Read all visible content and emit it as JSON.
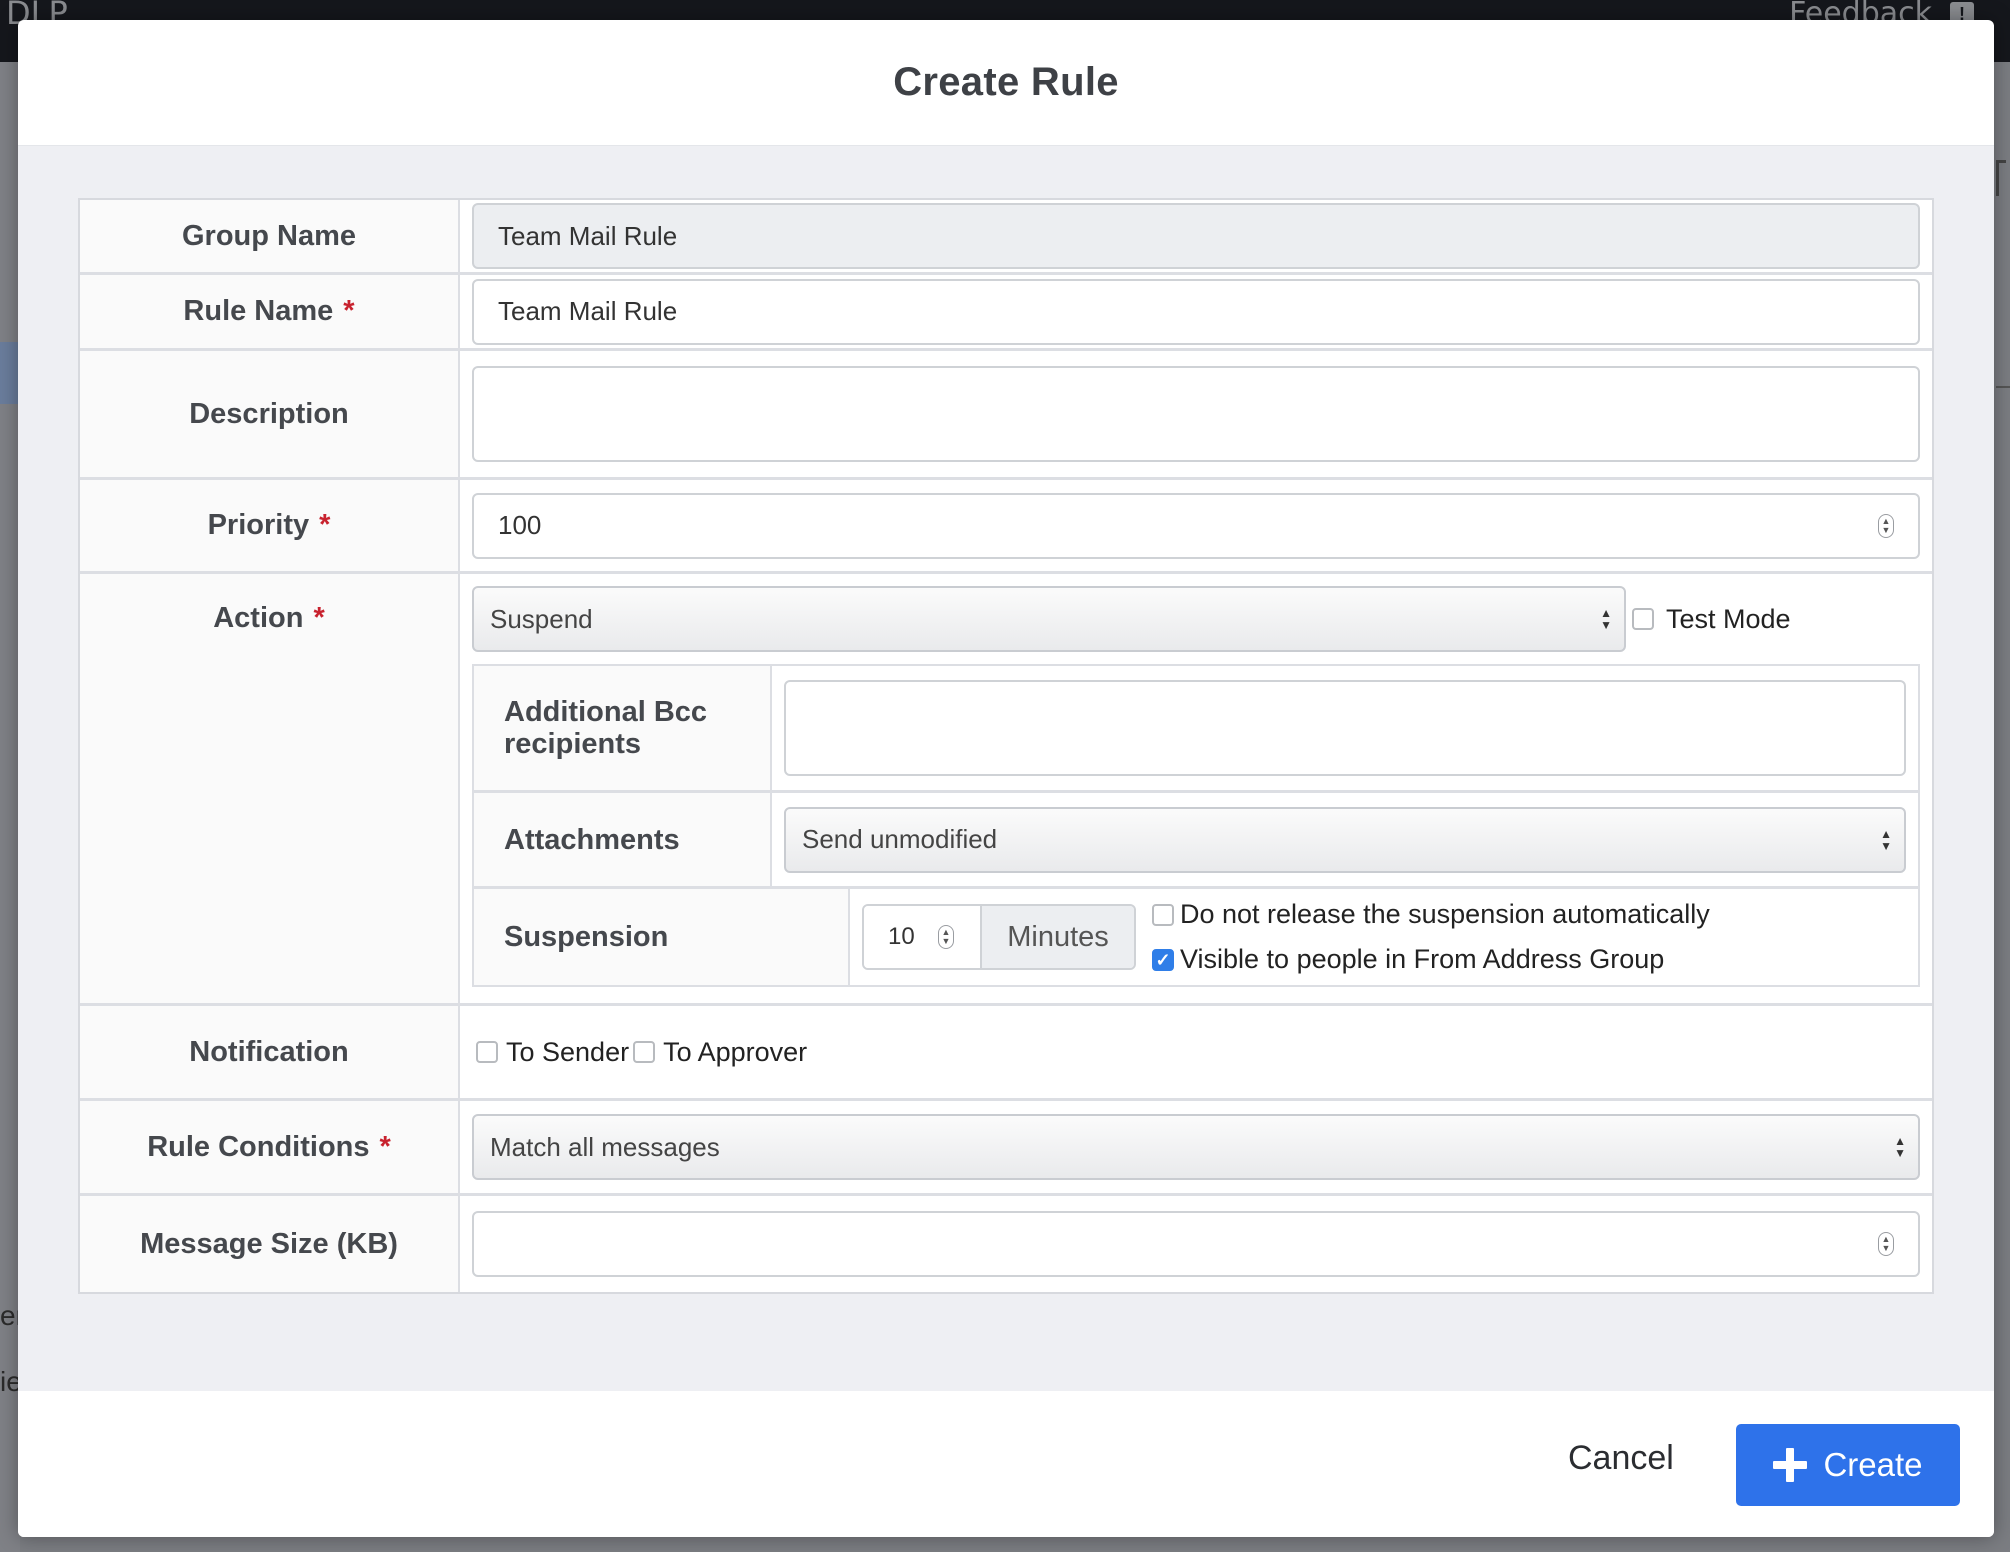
{
  "background": {
    "app_title": "DLP",
    "feedback_label": "Feedback",
    "feedback_icon": "!",
    "side_text_1": "er",
    "side_text_2": "ie"
  },
  "modal": {
    "title": "Create Rule"
  },
  "form": {
    "group_name": {
      "label": "Group Name",
      "value": "Team Mail Rule"
    },
    "rule_name": {
      "label": "Rule Name",
      "required_mark": "*",
      "value": "Team Mail Rule"
    },
    "description": {
      "label": "Description",
      "value": ""
    },
    "priority": {
      "label": "Priority",
      "required_mark": "*",
      "value": "100"
    },
    "action": {
      "label": "Action",
      "required_mark": "*",
      "selected": "Suspend",
      "test_mode_label": "Test Mode",
      "test_mode_checked": false,
      "bcc": {
        "label": "Additional Bcc recipients",
        "value": ""
      },
      "attachments": {
        "label": "Attachments",
        "selected": "Send unmodified"
      },
      "suspension": {
        "label": "Suspension",
        "value": "10",
        "unit": "Minutes",
        "no_auto_release_label": "Do not release the suspension automatically",
        "no_auto_release_checked": false,
        "visible_label": "Visible to people in From Address Group",
        "visible_checked": true
      }
    },
    "notification": {
      "label": "Notification",
      "to_sender_label": "To Sender",
      "to_sender_checked": false,
      "to_approver_label": "To Approver",
      "to_approver_checked": false
    },
    "rule_conditions": {
      "label": "Rule Conditions",
      "required_mark": "*",
      "selected": "Match all messages"
    },
    "message_size": {
      "label": "Message Size (KB)",
      "value": ""
    }
  },
  "footer": {
    "cancel_label": "Cancel",
    "create_label": "Create"
  },
  "colors": {
    "primary": "#2e72ea",
    "required": "#c8222e",
    "checkbox_checked": "#2f7ee8"
  }
}
